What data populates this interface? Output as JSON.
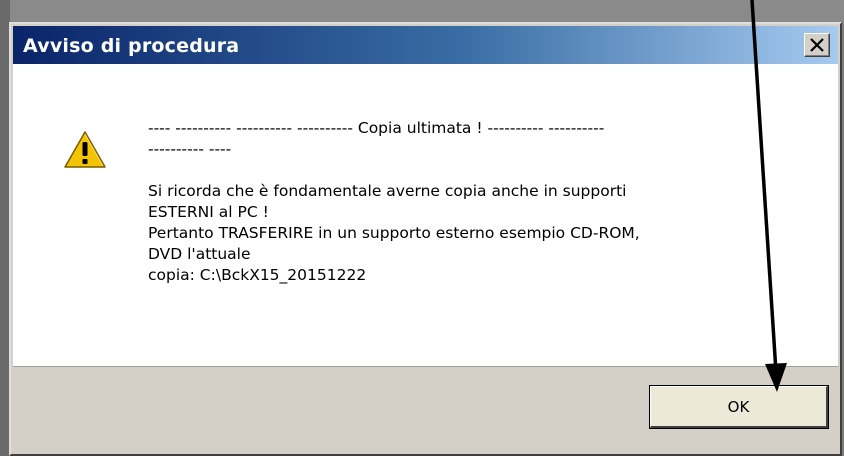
{
  "dialog": {
    "title": "Avviso di procedura",
    "close_label": "close",
    "icon": "warning-icon",
    "message": {
      "line1": "---- ---------- ---------- ---------- Copia ultimata ! ---------- ----------",
      "line2": "---------- ----",
      "line3": "Si ricorda che è fondamentale averne copia anche in supporti",
      "line4": "ESTERNI al PC !",
      "line5": "Pertanto TRASFERIRE in un supporto esterno esempio CD-ROM,",
      "line6": "DVD l'attuale",
      "line7": "copia:  C:\\BckX15_20151222"
    },
    "ok_label": "OK"
  },
  "colors": {
    "title_gradient_start": "#0a246a",
    "title_gradient_end": "#a6caf0",
    "dialog_face": "#d4d0c8",
    "warning_yellow": "#f5c400",
    "arrow": "#000000"
  }
}
